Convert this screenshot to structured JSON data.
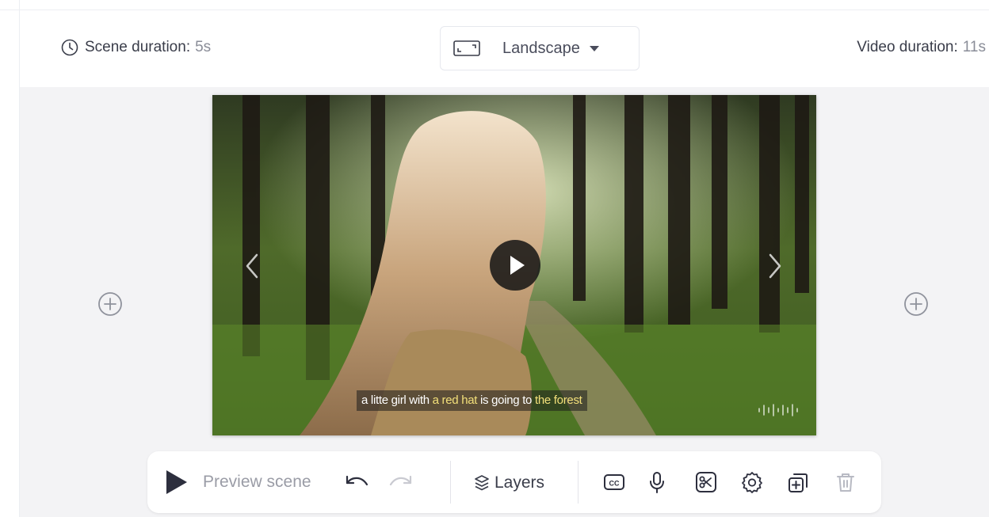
{
  "header": {
    "scene_duration_label": "Scene duration:",
    "scene_duration_value": "5s",
    "orientation_label": "Landscape",
    "video_duration_label": "Video duration:",
    "video_duration_value": "11s"
  },
  "player": {
    "subtitle": {
      "w1": "a litte girl with ",
      "h1": "a red hat",
      "w2": " is going to ",
      "h2": "the forest"
    }
  },
  "toolbar": {
    "preview_label": "Preview scene",
    "layers_label": "Layers"
  },
  "icons": [
    "clock-icon",
    "frame-icon",
    "chevron-down-icon",
    "plus-circle-icon",
    "play-icon",
    "chevron-left-icon",
    "chevron-right-icon",
    "waveform-icon",
    "undo-icon",
    "redo-icon",
    "layers-icon",
    "closed-captions-icon",
    "microphone-icon",
    "scissors-icon",
    "gear-icon",
    "add-copy-icon",
    "trash-icon"
  ],
  "colors": {
    "subtitle_highlight": "#f3e07a",
    "stage_background": "#f3f3f5",
    "accent_dark": "#2d2f3e"
  }
}
